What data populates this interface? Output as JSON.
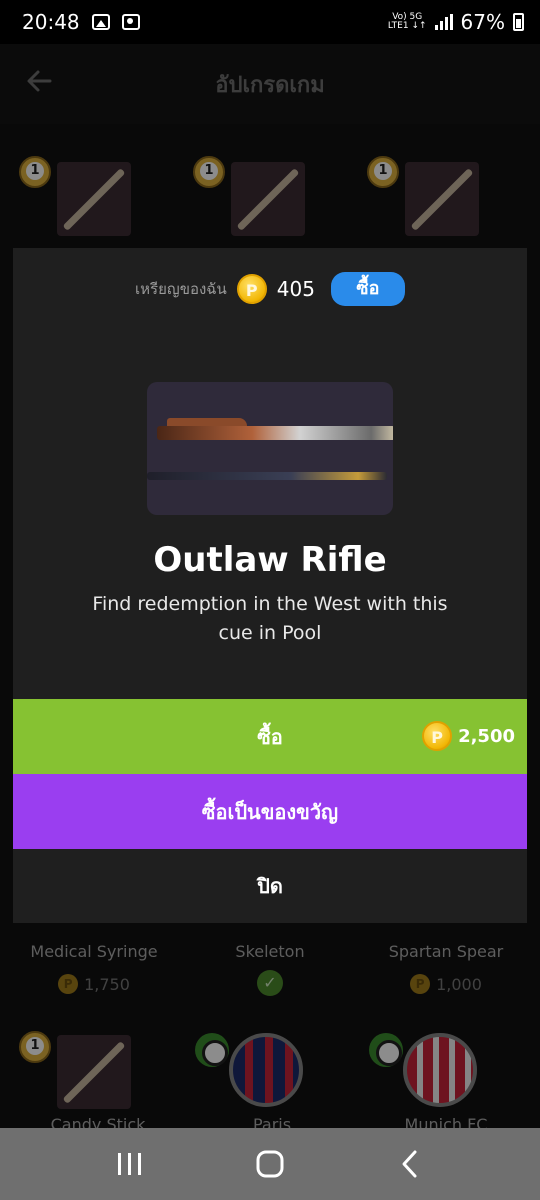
{
  "status_bar": {
    "time": "20:48",
    "network_top": "Vo) 5G",
    "network_bottom": "LTE1 ↓↑",
    "battery": "67%"
  },
  "header": {
    "title": "อัปเกรดเกม",
    "back_icon": "arrow-left-icon"
  },
  "background_items": {
    "row_bottom": [
      {
        "name": "Medical Syringe",
        "price": "1,750",
        "owned": false
      },
      {
        "name": "Skeleton",
        "price": "",
        "owned": true
      },
      {
        "name": "Spartan Spear",
        "price": "1,000",
        "owned": false
      }
    ],
    "row_last": [
      {
        "name": "Candy Stick"
      },
      {
        "name": "Paris"
      },
      {
        "name": "Munich FC"
      }
    ]
  },
  "modal": {
    "coins_label": "เหรียญของฉัน",
    "coin_symbol": "P",
    "coins_value": "405",
    "buy_coins_label": "ซื้อ",
    "item_title": "Outlaw Rifle",
    "item_description": "Find redemption in the West with this cue in Pool",
    "buy_label": "ซื้อ",
    "price": "2,500",
    "gift_label": "ซื้อเป็นของขวัญ",
    "close_label": "ปิด"
  },
  "colors": {
    "buy_green": "#86c232",
    "gift_purple": "#9a3ef0",
    "coin_button_blue": "#2a8bea"
  },
  "nav_bar": {
    "icons": [
      "recent-apps-icon",
      "home-icon",
      "back-icon"
    ]
  }
}
